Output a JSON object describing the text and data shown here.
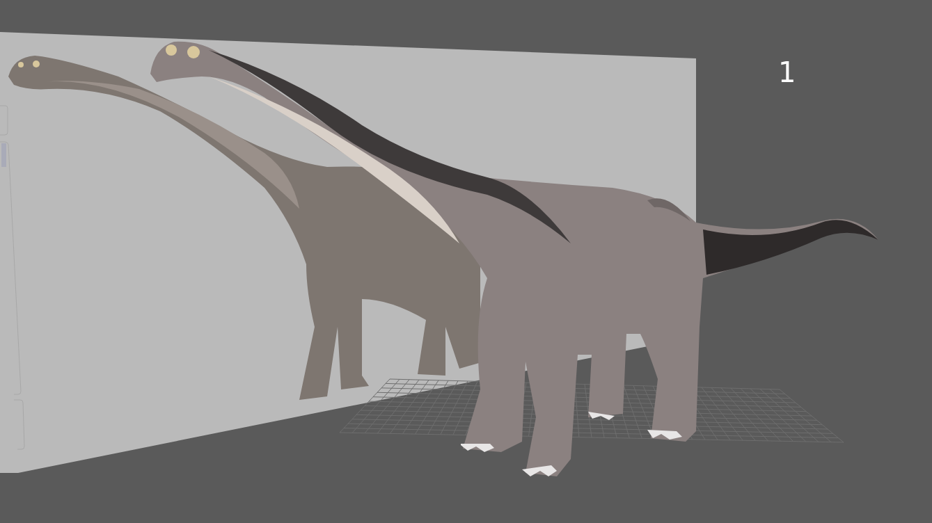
{
  "viewport": {
    "camera_label": "1"
  }
}
